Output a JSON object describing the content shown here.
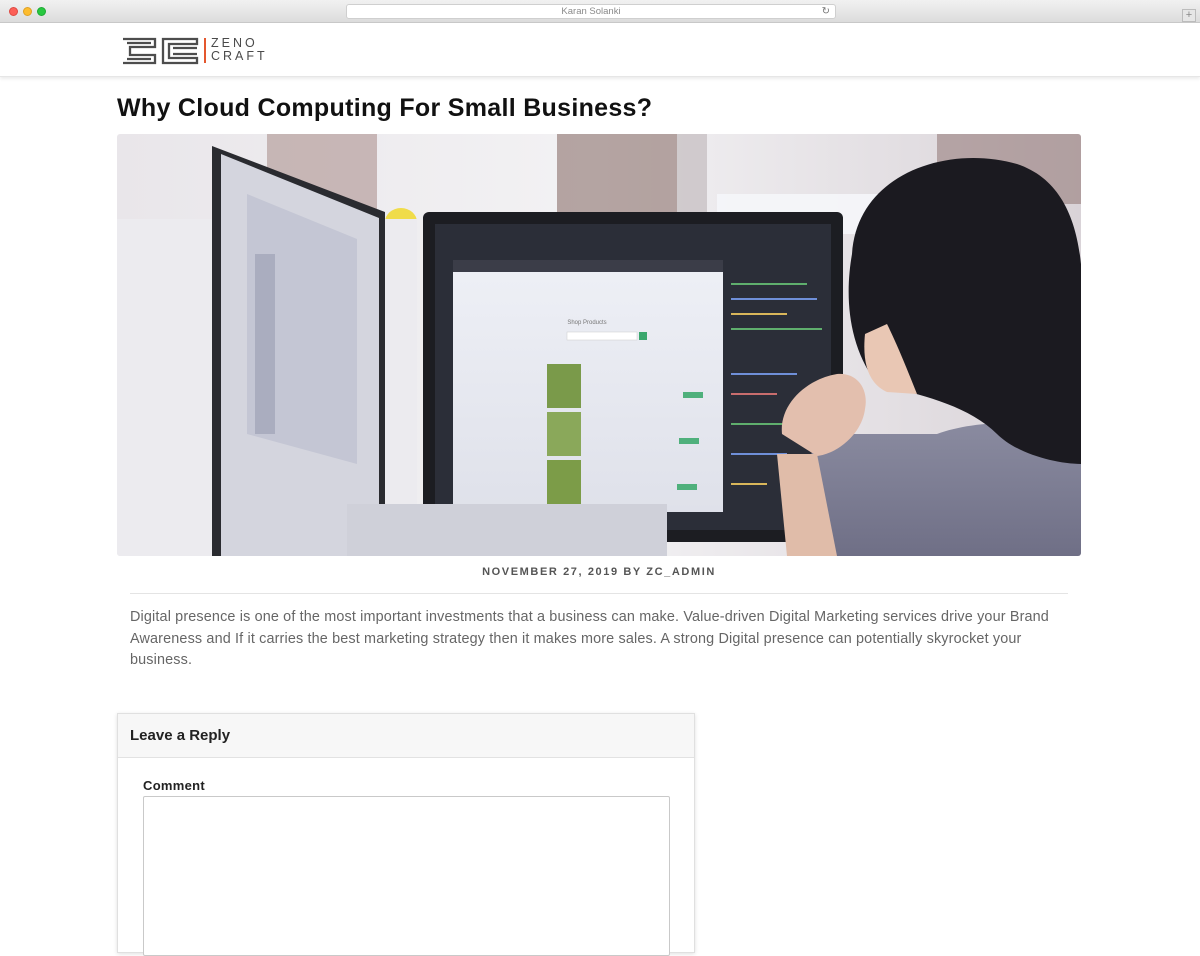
{
  "browser": {
    "url_title": "Karan Solanki",
    "new_tab_label": "+"
  },
  "site": {
    "logo_line1": "ZENO",
    "logo_line2": "CRAFT",
    "accent": "#e4572e"
  },
  "post": {
    "title": "Why Cloud Computing For Small Business?",
    "meta": "NOVEMBER 27, 2019 BY ZC_ADMIN",
    "body": "Digital presence is one of the most important investments that a business can make. Value-driven Digital Marketing services drive your Brand Awareness and If it carries the best marketing strategy then it makes more sales. A strong Digital presence can potentially skyrocket your business.",
    "screen_heading": "Shop Products"
  },
  "comments": {
    "heading": "Leave a Reply",
    "comment_label": "Comment",
    "comment_value": ""
  }
}
